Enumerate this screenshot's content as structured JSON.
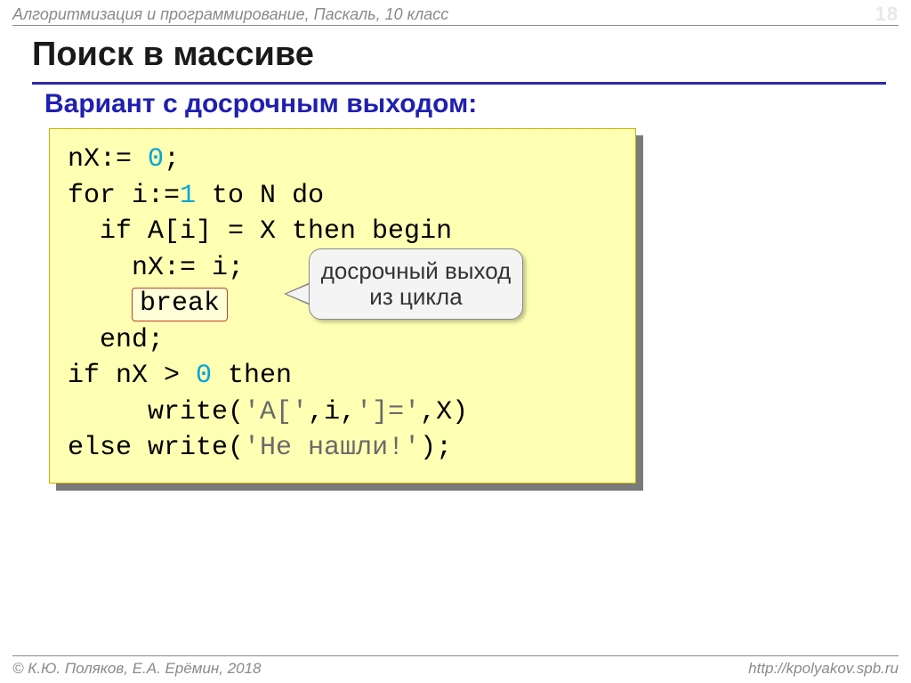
{
  "header": {
    "subject": "Алгоритмизация и программирование, Паскаль, 10 класс",
    "page_number": "18"
  },
  "title": "Поиск в массиве",
  "subtitle": "Вариант с досрочным выходом:",
  "code": {
    "l1a": "nX:= ",
    "l1b": "0",
    "l1c": ";",
    "l2a": "for i:=",
    "l2b": "1",
    "l2c": " to N do",
    "l3": "  if A[i] = X then begin",
    "l4": "    nX:= i;",
    "l5_prefix": "    ",
    "l5_break": "break",
    "l6": "  end;",
    "l7a": "if nX > ",
    "l7b": "0",
    "l7c": " then",
    "l8a": "     write(",
    "l8b": "'A['",
    "l8c": ",i,",
    "l8d": "']='",
    "l8e": ",X)",
    "l9a": "else write(",
    "l9b": "'Не нашли!'",
    "l9c": ");"
  },
  "callout": "досрочный выход из цикла",
  "footer": {
    "authors": "© К.Ю. Поляков, Е.А. Ерёмин, 2018",
    "url": "http://kpolyakov.spb.ru"
  }
}
